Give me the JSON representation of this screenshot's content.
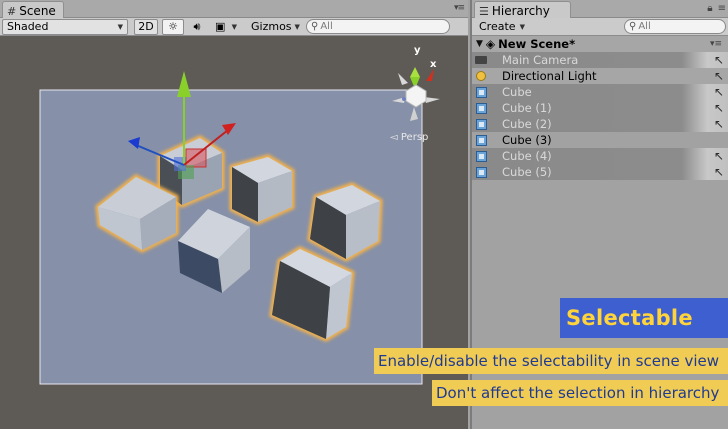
{
  "scene": {
    "tab_label": "Scene",
    "toolbar": {
      "shading_mode": "Shaded",
      "mode_2d": "2D",
      "gizmos_label": "Gizmos",
      "search_placeholder": "All"
    },
    "view": {
      "projection_label": "Persp",
      "axis_x": "x",
      "axis_y": "y"
    }
  },
  "hierarchy": {
    "tab_label": "Hierarchy",
    "create_label": "Create",
    "search_placeholder": "All",
    "scene_name": "New Scene*",
    "items": [
      {
        "label": "Main Camera",
        "icon": "camera-icon",
        "state": "grayed"
      },
      {
        "label": "Directional Light",
        "icon": "light-icon",
        "state": "normal"
      },
      {
        "label": "Cube",
        "icon": "cube-icon",
        "state": "grayed"
      },
      {
        "label": "Cube (1)",
        "icon": "cube-icon",
        "state": "grayed"
      },
      {
        "label": "Cube (2)",
        "icon": "cube-icon",
        "state": "grayed"
      },
      {
        "label": "Cube (3)",
        "icon": "cube-icon",
        "state": "normal"
      },
      {
        "label": "Cube (4)",
        "icon": "cube-icon",
        "state": "grayed"
      },
      {
        "label": "Cube (5)",
        "icon": "cube-icon",
        "state": "grayed"
      }
    ]
  },
  "caption": {
    "title": "Selectable",
    "line1": "Enable/disable the selectability in scene view",
    "line2": "Don't affect the selection in hierarchy"
  },
  "colors": {
    "caption_title_bg": "#3d5fd0",
    "caption_title_fg": "#ffd43b",
    "caption_line_bg": "#f0cc54",
    "caption_line_fg": "#1f3a93",
    "selection_outline": "#f5b24a"
  }
}
